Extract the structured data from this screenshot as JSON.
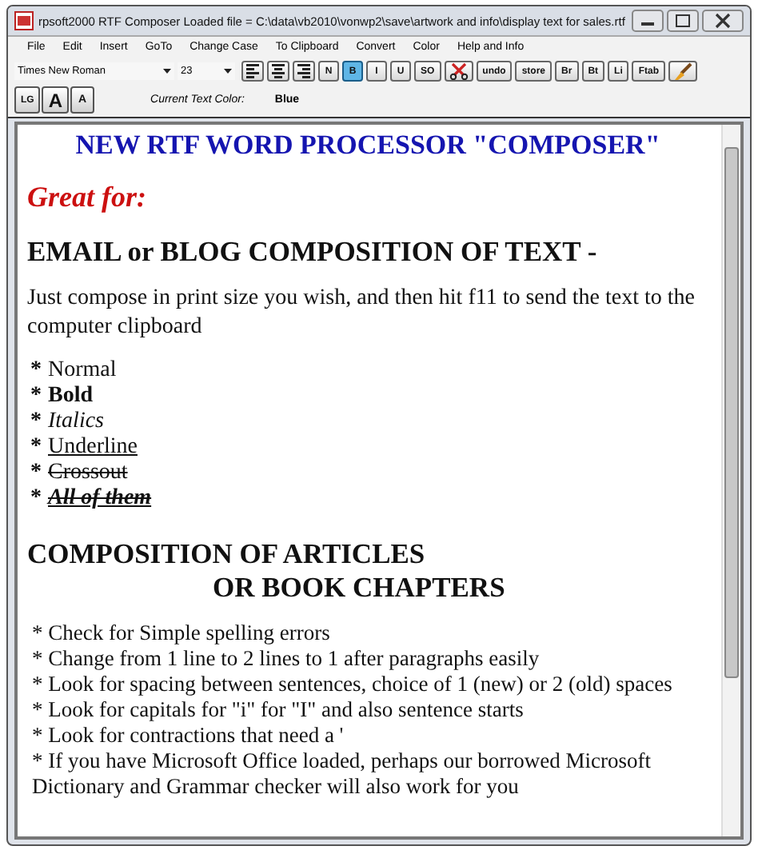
{
  "window": {
    "title": "rpsoft2000 RTF Composer  Loaded file = C:\\data\\vb2010\\vonwp2\\save\\artwork and info\\display text for sales.rtf"
  },
  "menu": [
    "File",
    "Edit",
    "Insert",
    "GoTo",
    "Change Case",
    "To Clipboard",
    "Convert",
    "Color",
    "Help and Info"
  ],
  "toolbar": {
    "font": "Times New Roman",
    "size": "23",
    "buttons": [
      {
        "kind": "align-left",
        "selected": false
      },
      {
        "kind": "align-center",
        "selected": false
      },
      {
        "kind": "align-right",
        "selected": false
      },
      {
        "kind": "text",
        "label": "N",
        "selected": false
      },
      {
        "kind": "text",
        "label": "B",
        "selected": true
      },
      {
        "kind": "text",
        "label": "I",
        "selected": false
      },
      {
        "kind": "text",
        "label": "U",
        "selected": false
      },
      {
        "kind": "text",
        "label": "SO",
        "selected": false
      },
      {
        "kind": "cut",
        "selected": false
      },
      {
        "kind": "text",
        "label": "undo",
        "selected": false
      },
      {
        "kind": "text",
        "label": "store",
        "selected": false
      },
      {
        "kind": "text",
        "label": "Br",
        "selected": false
      },
      {
        "kind": "text",
        "label": "Bt",
        "selected": false
      },
      {
        "kind": "text",
        "label": "Li",
        "selected": false
      },
      {
        "kind": "text",
        "label": "Ftab",
        "selected": false
      },
      {
        "kind": "brush",
        "selected": false
      }
    ]
  },
  "size_buttons": [
    "LG",
    "A",
    "A"
  ],
  "color_label": "Current Text Color:",
  "color_value": "Blue",
  "document": [
    {
      "kind": "title",
      "text": "NEW RTF WORD PROCESSOR \"COMPOSER\""
    },
    {
      "kind": "subtitle",
      "text": "Great for:"
    },
    {
      "kind": "heading",
      "text": "EMAIL or BLOG COMPOSITION OF TEXT -"
    },
    {
      "kind": "para",
      "text": "Just compose in print size you wish, and then hit f11 to send the text to the computer clipboard"
    },
    {
      "kind": "bullets",
      "items": [
        {
          "bullet": "*",
          "text": "Normal",
          "kind": "normal"
        },
        {
          "bullet": "*",
          "text": "Bold",
          "kind": "bold"
        },
        {
          "bullet": "*",
          "text": "Italics",
          "kind": "italic"
        },
        {
          "bullet": "*",
          "text": "Underline",
          "kind": "underline"
        },
        {
          "bullet": "*",
          "text": "Crossout",
          "kind": "strike"
        },
        {
          "bullet": "*",
          "text": "All of them",
          "kind": "all"
        }
      ]
    },
    {
      "kind": "heading",
      "text": "COMPOSITION OF ARTICLES"
    },
    {
      "kind": "heading-indent",
      "text": "OR BOOK CHAPTERS"
    },
    {
      "kind": "plain-list",
      "items": [
        "* Check for Simple spelling errors",
        "* Change from 1 line to 2 lines to 1 after paragraphs easily",
        "* Look for spacing between sentences, choice of 1 (new) or 2 (old) spaces",
        "* Look for capitals for \"i\" for \"I\" and also sentence starts",
        "* Look for contractions that need a '",
        "* If you have Microsoft Office loaded, perhaps our borrowed Microsoft Dictionary and Grammar checker will also work for you"
      ]
    }
  ]
}
